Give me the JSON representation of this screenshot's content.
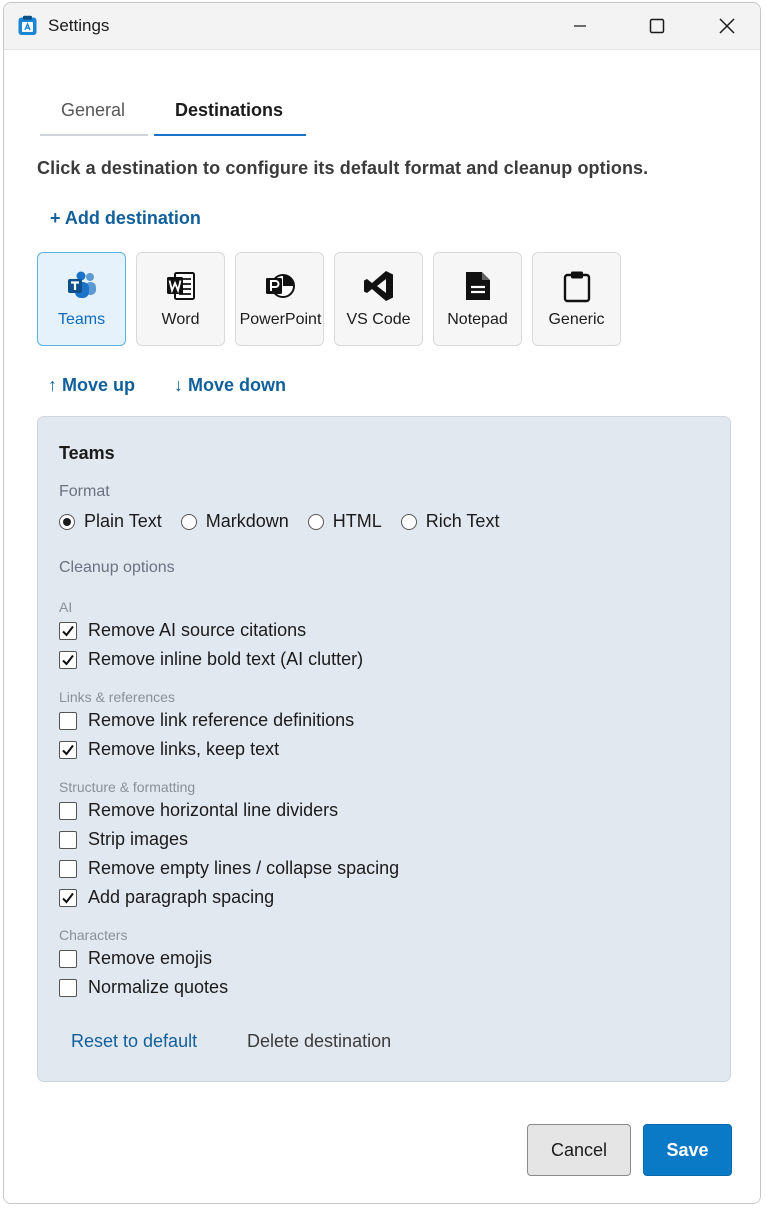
{
  "window": {
    "title": "Settings"
  },
  "tabs": [
    {
      "label": "General",
      "active": false
    },
    {
      "label": "Destinations",
      "active": true
    }
  ],
  "intro": "Click a destination to configure its default format and cleanup options.",
  "add_destination": "+ Add destination",
  "destinations": [
    {
      "label": "Teams",
      "icon": "teams-icon",
      "selected": true
    },
    {
      "label": "Word",
      "icon": "word-icon",
      "selected": false
    },
    {
      "label": "PowerPoint",
      "icon": "powerpoint-icon",
      "selected": false
    },
    {
      "label": "VS Code",
      "icon": "vscode-icon",
      "selected": false
    },
    {
      "label": "Notepad",
      "icon": "notepad-icon",
      "selected": false
    },
    {
      "label": "Generic",
      "icon": "clipboard-icon",
      "selected": false
    }
  ],
  "move_up": "↑ Move up",
  "move_down": "↓ Move down",
  "panel": {
    "title": "Teams",
    "format_label": "Format",
    "formats": [
      {
        "label": "Plain Text",
        "selected": true
      },
      {
        "label": "Markdown",
        "selected": false
      },
      {
        "label": "HTML",
        "selected": false
      },
      {
        "label": "Rich Text",
        "selected": false
      }
    ],
    "cleanup_label": "Cleanup options",
    "groups": [
      {
        "label": "AI",
        "options": [
          {
            "label": "Remove AI source citations",
            "checked": true
          },
          {
            "label": "Remove inline bold text (AI clutter)",
            "checked": true
          }
        ]
      },
      {
        "label": "Links & references",
        "options": [
          {
            "label": "Remove link reference definitions",
            "checked": false
          },
          {
            "label": "Remove links, keep text",
            "checked": true
          }
        ]
      },
      {
        "label": "Structure & formatting",
        "options": [
          {
            "label": "Remove horizontal line dividers",
            "checked": false
          },
          {
            "label": "Strip images",
            "checked": false
          },
          {
            "label": "Remove empty lines / collapse spacing",
            "checked": false
          },
          {
            "label": "Add paragraph spacing",
            "checked": true
          }
        ]
      },
      {
        "label": "Characters",
        "options": [
          {
            "label": "Remove emojis",
            "checked": false
          },
          {
            "label": "Normalize quotes",
            "checked": false
          }
        ]
      }
    ],
    "reset_label": "Reset to default",
    "delete_label": "Delete destination"
  },
  "buttons": {
    "cancel": "Cancel",
    "save": "Save"
  },
  "colors": {
    "accent": "#0b7ac6",
    "link": "#11609a",
    "panel_bg": "#e2e8f0",
    "selected_tile_bg": "#e5f1fb",
    "selected_tile_border": "#5ab2e6"
  }
}
